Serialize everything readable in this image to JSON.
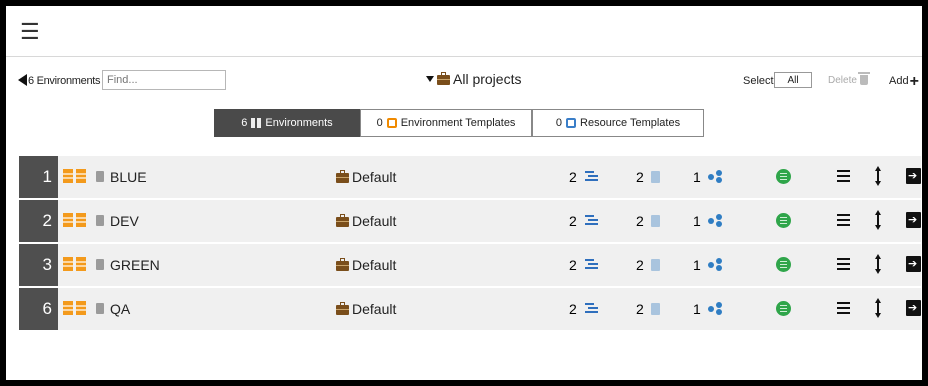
{
  "header": {
    "menu_icon": "hamburger-icon"
  },
  "toolbar": {
    "env_count_label": "6 Environments",
    "find_placeholder": "Find...",
    "projects_label": "All projects",
    "select_label": "Select",
    "select_value": "All",
    "delete_label": "Delete",
    "add_label": "Add"
  },
  "tabs": [
    {
      "count": "6",
      "label": "Environments",
      "icon": "environment-icon",
      "active": true
    },
    {
      "count": "0",
      "label": "Environment Templates",
      "icon": "environment-template-icon",
      "active": false
    },
    {
      "count": "0",
      "label": "Resource Templates",
      "icon": "resource-template-icon",
      "active": false
    }
  ],
  "environments": [
    {
      "index": "1",
      "name": "BLUE",
      "project": "Default",
      "processes": "2",
      "resources": "2",
      "nodes": "1"
    },
    {
      "index": "2",
      "name": "DEV",
      "project": "Default",
      "processes": "2",
      "resources": "2",
      "nodes": "1"
    },
    {
      "index": "3",
      "name": "GREEN",
      "project": "Default",
      "processes": "2",
      "resources": "2",
      "nodes": "1"
    },
    {
      "index": "6",
      "name": "QA",
      "project": "Default",
      "processes": "2",
      "resources": "2",
      "nodes": "1"
    }
  ],
  "colors": {
    "accent_orange": "#f39a1c",
    "accent_blue": "#2f6fbd",
    "status_green": "#2fa54a",
    "tab_active": "#4a4a4a"
  }
}
